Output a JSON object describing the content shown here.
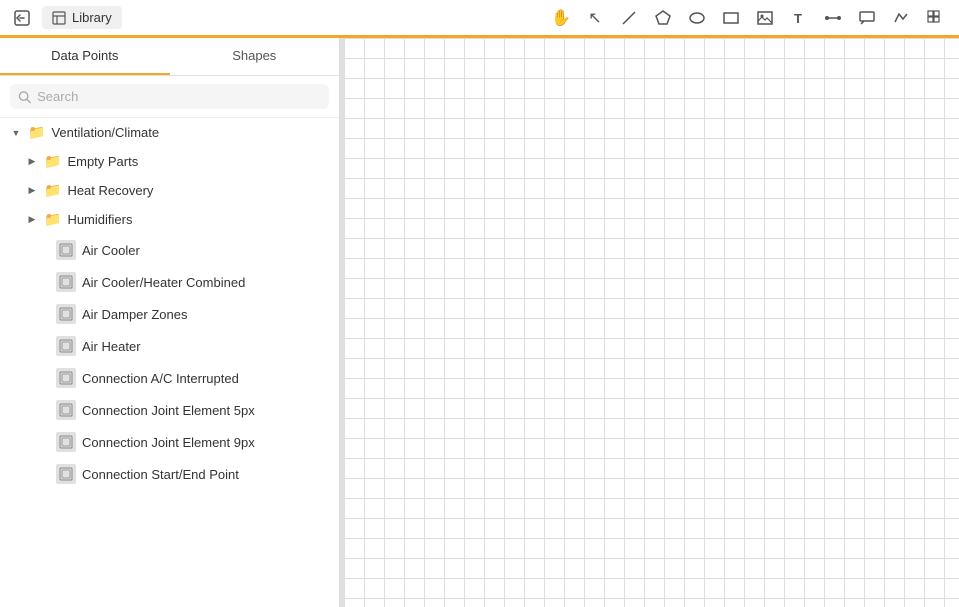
{
  "topbar": {
    "back_icon": "←",
    "library_icon": "☰",
    "library_label": "Library",
    "tools": [
      {
        "name": "pan-tool",
        "symbol": "✋"
      },
      {
        "name": "select-tool",
        "symbol": "↖"
      },
      {
        "name": "line-tool",
        "symbol": "╱"
      },
      {
        "name": "polygon-tool",
        "symbol": "⬠"
      },
      {
        "name": "ellipse-tool",
        "symbol": "○"
      },
      {
        "name": "rectangle-tool",
        "symbol": "▭"
      },
      {
        "name": "image-tool",
        "symbol": "⬜"
      },
      {
        "name": "text-tool",
        "symbol": "T"
      },
      {
        "name": "connector-tool",
        "symbol": "—"
      },
      {
        "name": "callout-tool",
        "symbol": "▭"
      },
      {
        "name": "multiline-tool",
        "symbol": "⤢"
      },
      {
        "name": "grid-tool",
        "symbol": "⊞"
      }
    ]
  },
  "tabs": [
    {
      "label": "Data Points",
      "active": true
    },
    {
      "label": "Shapes",
      "active": false
    }
  ],
  "search": {
    "placeholder": "Search"
  },
  "tree": {
    "root": {
      "label": "Ventilation/Climate",
      "expanded": true,
      "children": [
        {
          "label": "Empty Parts",
          "type": "folder",
          "expanded": false,
          "children": []
        },
        {
          "label": "Heat Recovery",
          "type": "folder",
          "expanded": false,
          "children": []
        },
        {
          "label": "Humidifiers",
          "type": "folder",
          "expanded": false,
          "children": []
        },
        {
          "label": "Air Cooler",
          "type": "item"
        },
        {
          "label": "Air Cooler/Heater Combined",
          "type": "item"
        },
        {
          "label": "Air Damper Zones",
          "type": "item"
        },
        {
          "label": "Air Heater",
          "type": "item"
        },
        {
          "label": "Connection A/C Interrupted",
          "type": "item"
        },
        {
          "label": "Connection Joint Element 5px",
          "type": "item"
        },
        {
          "label": "Connection Joint Element 9px",
          "type": "item"
        },
        {
          "label": "Connection Start/End Point",
          "type": "item"
        }
      ]
    }
  }
}
